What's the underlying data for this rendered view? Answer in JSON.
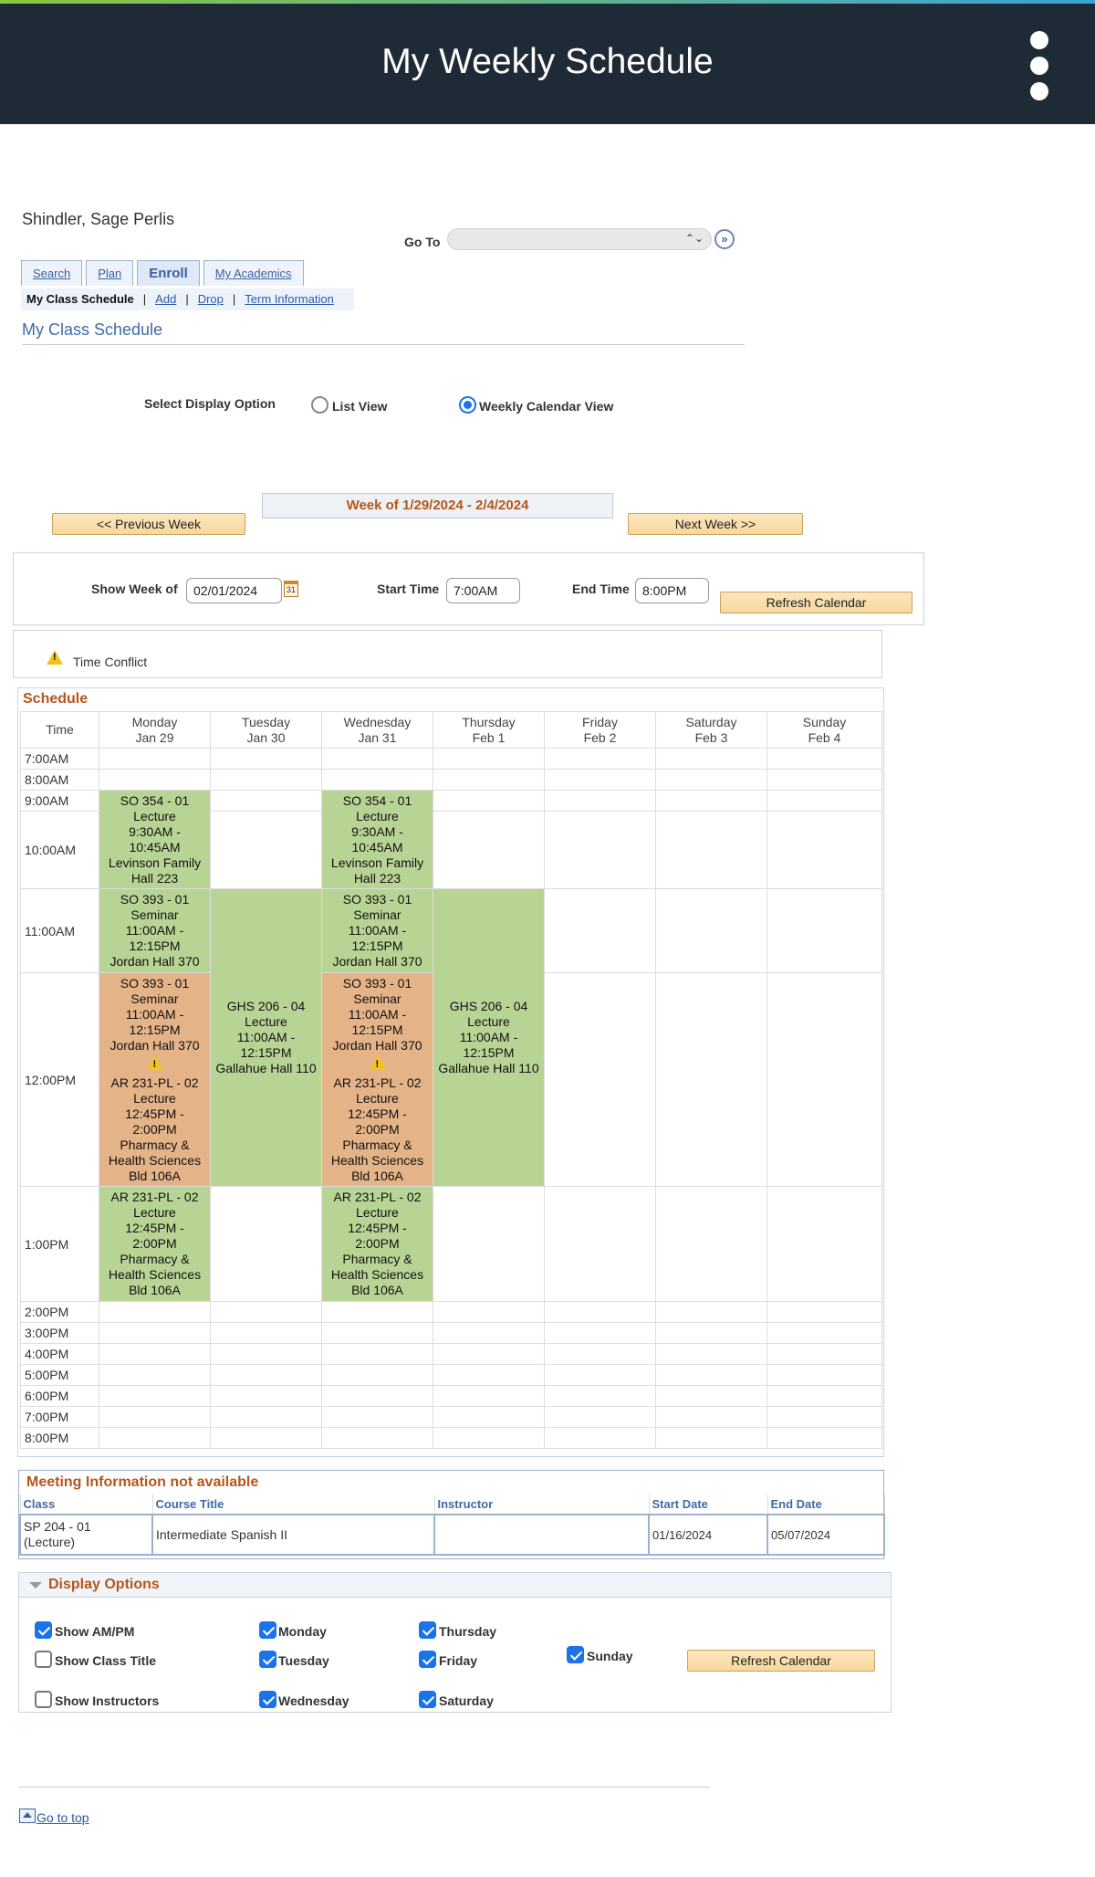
{
  "header": {
    "title": "My Weekly Schedule",
    "menu_icon": "kebab-menu-icon"
  },
  "student_name": "Shindler, Sage Perlis",
  "goto": {
    "label": "Go To",
    "value": ""
  },
  "tabs": [
    {
      "label": "Search"
    },
    {
      "label": "Plan"
    },
    {
      "label": "Enroll",
      "active": true
    },
    {
      "label": "My Academics"
    }
  ],
  "subnav": {
    "current": "My Class Schedule",
    "links": [
      "Add",
      "Drop",
      "Term Information"
    ]
  },
  "page_title": "My Class Schedule",
  "display_option": {
    "label": "Select Display Option",
    "options": [
      "List View",
      "Weekly Calendar View"
    ],
    "selected": "Weekly Calendar View"
  },
  "week": {
    "title": "Week of 1/29/2024 - 2/4/2024",
    "prev_label": "<< Previous Week",
    "next_label": "Next Week >>"
  },
  "controls": {
    "show_week_label": "Show Week of",
    "show_week_value": "02/01/2024",
    "start_time_label": "Start Time",
    "start_time_value": "7:00AM",
    "end_time_label": "End Time",
    "end_time_value": "8:00PM",
    "refresh_label": "Refresh Calendar",
    "calendar_icon_text": "31"
  },
  "legend": {
    "conflict_label": "Time Conflict"
  },
  "schedule": {
    "title": "Schedule",
    "time_header": "Time",
    "days": [
      {
        "day": "Monday",
        "date": "Jan 29"
      },
      {
        "day": "Tuesday",
        "date": "Jan 30"
      },
      {
        "day": "Wednesday",
        "date": "Jan 31"
      },
      {
        "day": "Thursday",
        "date": "Feb 1"
      },
      {
        "day": "Friday",
        "date": "Feb 2"
      },
      {
        "day": "Saturday",
        "date": "Feb 3"
      },
      {
        "day": "Sunday",
        "date": "Feb 4"
      }
    ],
    "times": [
      "7:00AM",
      "8:00AM",
      "9:00AM",
      "10:00AM",
      "11:00AM",
      "12:00PM",
      "1:00PM",
      "2:00PM",
      "3:00PM",
      "4:00PM",
      "5:00PM",
      "6:00PM",
      "7:00PM",
      "8:00PM"
    ],
    "events": {
      "so354": [
        "SO 354 - 01",
        "Lecture",
        "9:30AM -",
        "10:45AM",
        "Levinson Family",
        "Hall 223"
      ],
      "so393": [
        "SO 393 - 01",
        "Seminar",
        "11:00AM -",
        "12:15PM",
        "Jordan Hall 370"
      ],
      "ghs206": [
        "GHS 206 - 04",
        "Lecture",
        "11:00AM -",
        "12:15PM",
        "Gallahue Hall 110"
      ],
      "ar231": [
        "AR 231-PL - 02",
        "Lecture",
        "12:45PM -",
        "2:00PM",
        "Pharmacy &",
        "Health Sciences",
        "Bld 106A"
      ]
    },
    "colors": {
      "normal": "#b8d495",
      "conflict": "#e5b388"
    }
  },
  "meeting_info": {
    "title": "Meeting Information not available",
    "headers": [
      "Class",
      "Course Title",
      "Instructor",
      "Start Date",
      "End Date"
    ],
    "rows": [
      {
        "class": "SP  204 - 01\n(Lecture)",
        "title": "Intermediate Spanish II",
        "instructor": "",
        "start": "01/16/2024",
        "end": "05/07/2024"
      }
    ]
  },
  "display_options": {
    "title": "Display Options",
    "items": [
      {
        "label": "Show AM/PM",
        "checked": true
      },
      {
        "label": "Show Class Title",
        "checked": false
      },
      {
        "label": "Show Instructors",
        "checked": false
      },
      {
        "label": "Monday",
        "checked": true
      },
      {
        "label": "Tuesday",
        "checked": true
      },
      {
        "label": "Wednesday",
        "checked": true
      },
      {
        "label": "Thursday",
        "checked": true
      },
      {
        "label": "Friday",
        "checked": true
      },
      {
        "label": "Saturday",
        "checked": true
      },
      {
        "label": "Sunday",
        "checked": true
      }
    ],
    "refresh_label": "Refresh Calendar"
  },
  "footer": {
    "go_top": "Go to top"
  }
}
